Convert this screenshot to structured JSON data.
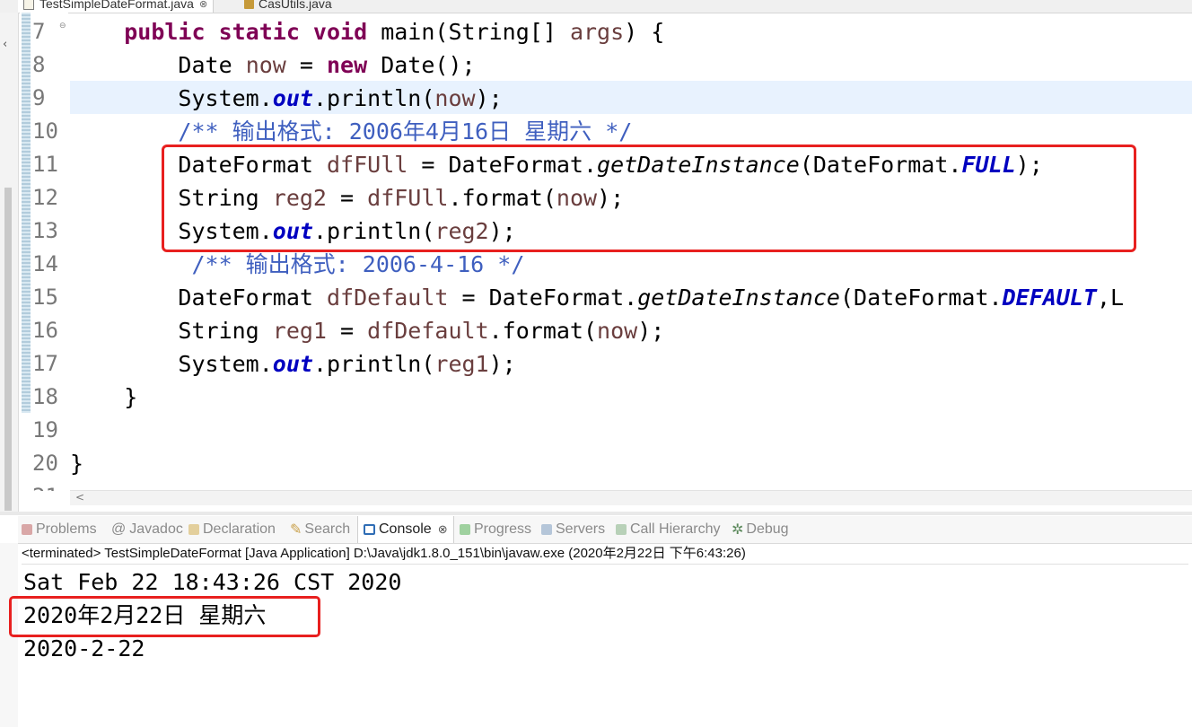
{
  "editor_tabs": [
    {
      "label": "TestSimpleDateFormat.java",
      "active": true
    },
    {
      "label": "CasUtils.java",
      "active": false
    }
  ],
  "tab_close_glyph": "⊗",
  "line_numbers": [
    "7",
    "8",
    "9",
    "10",
    "11",
    "12",
    "13",
    "14",
    "15",
    "16",
    "17",
    "18",
    "19",
    "20",
    "21"
  ],
  "code": {
    "l7": {
      "indent": "    ",
      "kw1": "public static void",
      "rest": " main(String[] ",
      "arg": "args",
      "end": ") {"
    },
    "l8": {
      "indent": "        ",
      "t1": "Date ",
      "var": "now",
      "t2": " = ",
      "kw": "new",
      "t3": " Date();"
    },
    "l9": {
      "indent": "        ",
      "t1": "System.",
      "fld": "out",
      "t2": ".println(",
      "var": "now",
      "t3": ");"
    },
    "l10": {
      "indent": "        ",
      "comment": "/** 输出格式: 2006年4月16日 星期六 */"
    },
    "l11": {
      "indent": "        ",
      "t1": "DateFormat ",
      "var": "dfFUll",
      "t2": " = DateFormat.",
      "stm": "getDateInstance",
      "t3": "(DateFormat.",
      "fld": "FULL",
      "t4": ");"
    },
    "l12": {
      "indent": "        ",
      "t1": "String ",
      "var": "reg2",
      "t2": " = ",
      "var2": "dfFUll",
      "t3": ".format(",
      "var3": "now",
      "t4": ");"
    },
    "l13": {
      "indent": "        ",
      "t1": "System.",
      "fld": "out",
      "t2": ".println(",
      "var": "reg2",
      "t3": ");"
    },
    "l14": {
      "indent": "         ",
      "comment": "/** 输出格式: 2006-4-16 */"
    },
    "l15": {
      "indent": "        ",
      "t1": "DateFormat ",
      "var": "dfDefault",
      "t2": " = DateFormat.",
      "stm": "getDateInstance",
      "t3": "(DateFormat.",
      "fld": "DEFAULT",
      "t4": ",L"
    },
    "l16": {
      "indent": "        ",
      "t1": "String ",
      "var": "reg1",
      "t2": " = ",
      "var2": "dfDefault",
      "t3": ".format(",
      "var3": "now",
      "t4": ");"
    },
    "l17": {
      "indent": "        ",
      "t1": "System.",
      "fld": "out",
      "t2": ".println(",
      "var": "reg1",
      "t3": ");"
    },
    "l18": {
      "text": "    }"
    },
    "l19": {
      "text": ""
    },
    "l20": {
      "text": "}"
    }
  },
  "view_tabs": [
    {
      "label": "Problems",
      "icon": "problems-icon",
      "color": "#c0504d"
    },
    {
      "label": "Javadoc",
      "icon": "at-icon",
      "color": "#9a9a9a"
    },
    {
      "label": "Declaration",
      "icon": "declaration-icon",
      "color": "#b5862f"
    },
    {
      "label": "Search",
      "icon": "search-icon",
      "color": "#c9a04a"
    },
    {
      "label": "Console",
      "icon": "console-icon",
      "color": "#2f6db5",
      "active": true
    },
    {
      "label": "Progress",
      "icon": "progress-icon",
      "color": "#4caf50"
    },
    {
      "label": "Servers",
      "icon": "servers-icon",
      "color": "#6b8fb5"
    },
    {
      "label": "Call Hierarchy",
      "icon": "call-hierarchy-icon",
      "color": "#5d8a5d"
    },
    {
      "label": "Debug",
      "icon": "debug-icon",
      "color": "#5d8a5d"
    }
  ],
  "console": {
    "status": "<terminated> TestSimpleDateFormat [Java Application] D:\\Java\\jdk1.8.0_151\\bin\\javaw.exe (2020年2月22日 下午6:43:26)",
    "output": [
      "Sat Feb 22 18:43:26 CST 2020",
      "2020年2月22日 星期六",
      "2020-2-22"
    ]
  },
  "colors": {
    "highlight_box": "#e8201f",
    "keyword": "#7f0055",
    "field": "#0000c0",
    "comment": "#3f5fbf",
    "local_var": "#6a3e3e"
  }
}
